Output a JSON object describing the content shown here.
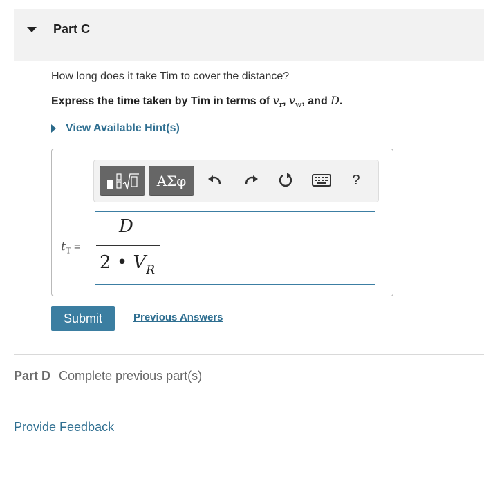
{
  "part_c": {
    "title": "Part C",
    "question": "How long does it take Tim to cover the distance?",
    "instruction_prefix": "Express the time taken by Tim in terms of ",
    "var_v": "v",
    "sub_r": "r",
    "sub_w": "w",
    "var_D": "D",
    "hint_label": "View Available Hint(s)"
  },
  "toolbar": {
    "greek_label": "ΑΣφ",
    "help_label": "?",
    "icons": [
      "templates-icon",
      "greek-symbols-icon",
      "undo-icon",
      "redo-icon",
      "reset-icon",
      "keyboard-icon",
      "help-icon"
    ]
  },
  "answer": {
    "variable": "t",
    "variable_sub": "T",
    "equals": "=",
    "numerator": "D",
    "denominator_coef": "2",
    "denominator_op": "•",
    "denominator_var": "V",
    "denominator_sub": "R"
  },
  "actions": {
    "submit_label": "Submit",
    "previous_answers_label": "Previous Answers"
  },
  "part_d": {
    "label": "Part D",
    "status": "Complete previous part(s)"
  },
  "footer": {
    "feedback_label": "Provide Feedback"
  },
  "colors": {
    "link": "#2f6f91",
    "submit_bg": "#3b7ea1",
    "formula_border": "#3c7ea3"
  }
}
